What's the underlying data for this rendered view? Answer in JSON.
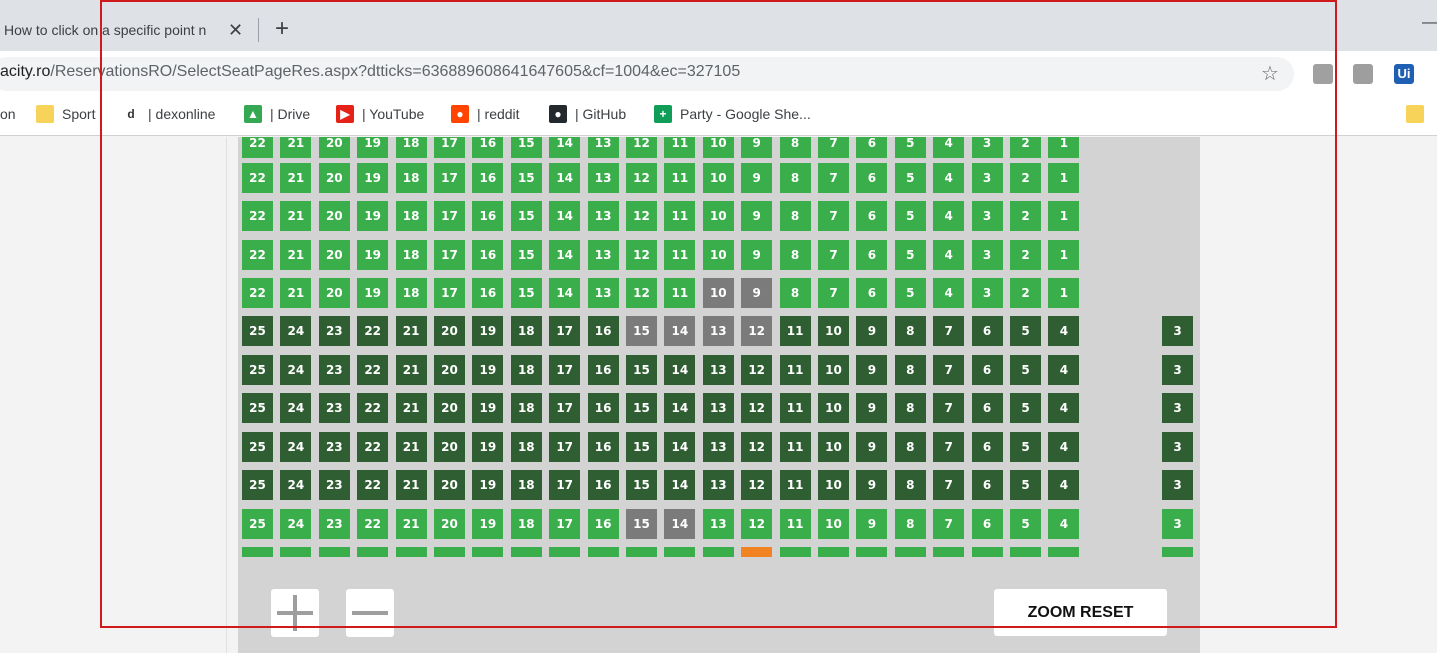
{
  "browser": {
    "tab_title": "How to click on a specific point n",
    "close_glyph": "✕",
    "new_tab_glyph": "+",
    "minimize_glyph": "—",
    "url_host": "acity.ro",
    "url_path": "/ReservationsRO/SelectSeatPageRes.aspx?dtticks=636889608641647605&cf=1004&ec=327105",
    "star_glyph": "☆",
    "extensions": [
      {
        "name": "pin-extension-icon",
        "text": "",
        "color": "#a0a0a0"
      },
      {
        "name": "tower-extension-icon",
        "text": "",
        "color": "#9e9e9e"
      },
      {
        "name": "ui-extension-icon",
        "text": "Ui",
        "color": "#1f5fb4"
      }
    ]
  },
  "bookmarks": [
    {
      "name": "bookmark-partial",
      "label": "on",
      "icon": "none"
    },
    {
      "name": "bookmark-sport",
      "label": "Sport",
      "icon": "folder-icon"
    },
    {
      "name": "bookmark-dexonline",
      "label": "| dexonline",
      "icon": "dexonline-icon"
    },
    {
      "name": "bookmark-drive",
      "label": "| Drive",
      "icon": "drive-icon"
    },
    {
      "name": "bookmark-youtube",
      "label": "| YouTube",
      "icon": "youtube-icon"
    },
    {
      "name": "bookmark-reddit",
      "label": "| reddit",
      "icon": "reddit-icon"
    },
    {
      "name": "bookmark-github",
      "label": "| GitHub",
      "icon": "github-icon"
    },
    {
      "name": "bookmark-party-sheet",
      "label": "Party - Google She...",
      "icon": "sheets-icon"
    }
  ],
  "seatmap": {
    "colors": {
      "free": "#39ae4b",
      "dark": "#2f5e32",
      "taken": "#7b7b7b",
      "selected": "#f28322"
    },
    "rows": [
      {
        "seats": [
          "22",
          "21",
          "20",
          "19",
          "18",
          "17",
          "16",
          "15",
          "14",
          "13",
          "12",
          "11",
          "10",
          "9",
          "8",
          "7",
          "6",
          "5",
          "4",
          "3",
          "2",
          "1"
        ],
        "status": [
          "free"
        ],
        "partial": "top"
      },
      {
        "seats": [
          "22",
          "21",
          "20",
          "19",
          "18",
          "17",
          "16",
          "15",
          "14",
          "13",
          "12",
          "11",
          "10",
          "9",
          "8",
          "7",
          "6",
          "5",
          "4",
          "3",
          "2",
          "1"
        ],
        "status": [
          "free"
        ]
      },
      {
        "seats": [
          "22",
          "21",
          "20",
          "19",
          "18",
          "17",
          "16",
          "15",
          "14",
          "13",
          "12",
          "11",
          "10",
          "9",
          "8",
          "7",
          "6",
          "5",
          "4",
          "3",
          "2",
          "1"
        ],
        "status": [
          "free"
        ]
      },
      {
        "seats": [
          "22",
          "21",
          "20",
          "19",
          "18",
          "17",
          "16",
          "15",
          "14",
          "13",
          "12",
          "11",
          "10",
          "9",
          "8",
          "7",
          "6",
          "5",
          "4",
          "3",
          "2",
          "1"
        ],
        "status": [
          "free"
        ]
      },
      {
        "seats": [
          "22",
          "21",
          "20",
          "19",
          "18",
          "17",
          "16",
          "15",
          "14",
          "13",
          "12",
          "11",
          "10",
          "9",
          "8",
          "7",
          "6",
          "5",
          "4",
          "3",
          "2",
          "1"
        ],
        "status": [
          "free"
        ],
        "taken": [
          "10",
          "9"
        ]
      },
      {
        "seats": [
          "25",
          "24",
          "23",
          "22",
          "21",
          "20",
          "19",
          "18",
          "17",
          "16",
          "15",
          "14",
          "13",
          "12",
          "11",
          "10",
          "9",
          "8",
          "7",
          "6",
          "5",
          "4"
        ],
        "extra": "3",
        "status": [
          "dark"
        ],
        "taken": [
          "15",
          "14",
          "13",
          "12"
        ]
      },
      {
        "seats": [
          "25",
          "24",
          "23",
          "22",
          "21",
          "20",
          "19",
          "18",
          "17",
          "16",
          "15",
          "14",
          "13",
          "12",
          "11",
          "10",
          "9",
          "8",
          "7",
          "6",
          "5",
          "4"
        ],
        "extra": "3",
        "status": [
          "dark"
        ]
      },
      {
        "seats": [
          "25",
          "24",
          "23",
          "22",
          "21",
          "20",
          "19",
          "18",
          "17",
          "16",
          "15",
          "14",
          "13",
          "12",
          "11",
          "10",
          "9",
          "8",
          "7",
          "6",
          "5",
          "4"
        ],
        "extra": "3",
        "status": [
          "dark"
        ]
      },
      {
        "seats": [
          "25",
          "24",
          "23",
          "22",
          "21",
          "20",
          "19",
          "18",
          "17",
          "16",
          "15",
          "14",
          "13",
          "12",
          "11",
          "10",
          "9",
          "8",
          "7",
          "6",
          "5",
          "4"
        ],
        "extra": "3",
        "status": [
          "dark"
        ]
      },
      {
        "seats": [
          "25",
          "24",
          "23",
          "22",
          "21",
          "20",
          "19",
          "18",
          "17",
          "16",
          "15",
          "14",
          "13",
          "12",
          "11",
          "10",
          "9",
          "8",
          "7",
          "6",
          "5",
          "4"
        ],
        "extra": "3",
        "status": [
          "dark"
        ]
      },
      {
        "seats": [
          "25",
          "24",
          "23",
          "22",
          "21",
          "20",
          "19",
          "18",
          "17",
          "16",
          "15",
          "14",
          "13",
          "12",
          "11",
          "10",
          "9",
          "8",
          "7",
          "6",
          "5",
          "4"
        ],
        "extra": "3",
        "status": [
          "free"
        ],
        "taken": [
          "15",
          "14"
        ]
      },
      {
        "seats": [
          "",
          "",
          "",
          "",
          "",
          "",
          "",
          "",
          "",
          "",
          "",
          "",
          "",
          "",
          "",
          "",
          "",
          "",
          "",
          "",
          "",
          ""
        ],
        "extra": "",
        "status": [
          "free"
        ],
        "selected_index": 13,
        "partial": "bottom"
      }
    ]
  },
  "controls": {
    "zoom_reset_label": "ZOOM RESET"
  }
}
